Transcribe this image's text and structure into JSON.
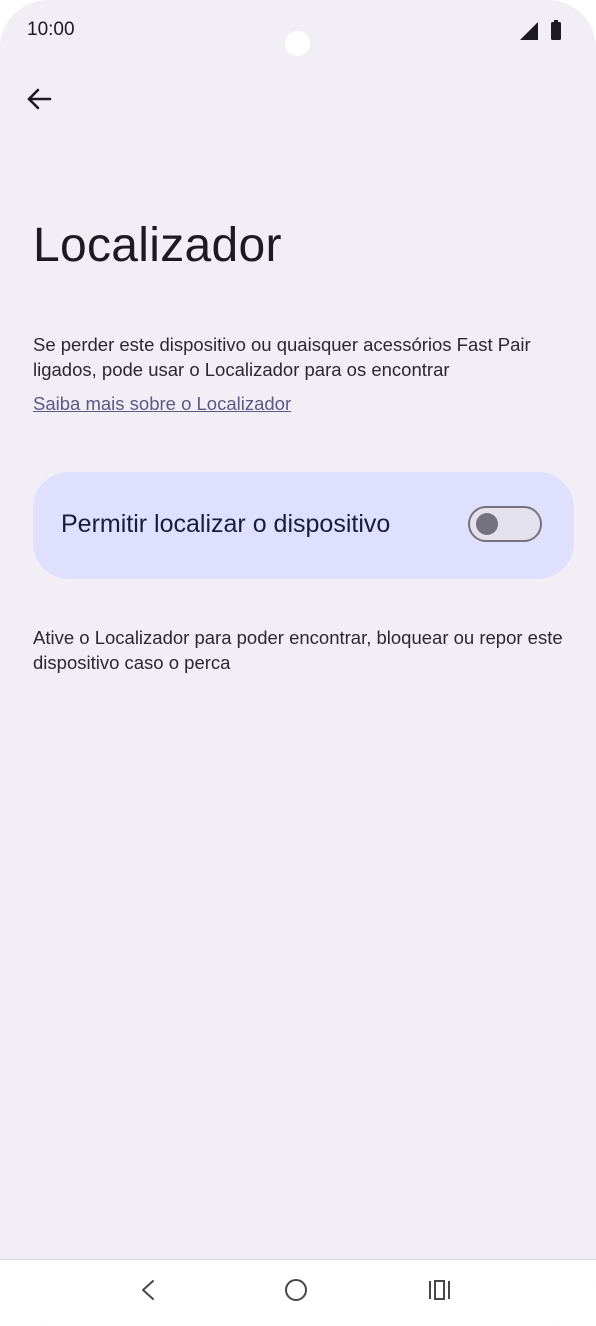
{
  "status_bar": {
    "time": "10:00",
    "signal_icon": "cell-signal-icon",
    "battery_icon": "battery-icon"
  },
  "toolbar": {
    "back_icon": "arrow-back-icon"
  },
  "page": {
    "title": "Localizador",
    "intro": "Se perder este dispositivo ou quaisquer acessórios Fast Pair ligados, pode usar o Localizador para os encontrar",
    "learn_more_link": "Saiba mais sobre o Localizador",
    "toggle": {
      "label": "Permitir localizar o dispositivo",
      "on": false
    },
    "footer_text": "Ative o Localizador para poder encontrar, bloquear ou repor este dispositivo caso o perca"
  },
  "navigation": {
    "back_icon": "chevron-back-icon",
    "home_icon": "circle-home-icon",
    "recents_icon": "recents-icon"
  },
  "colors": {
    "background": "#f1eef5",
    "card": "#dfe0fe",
    "link": "#5a5987",
    "switch_outline": "#74727c"
  }
}
